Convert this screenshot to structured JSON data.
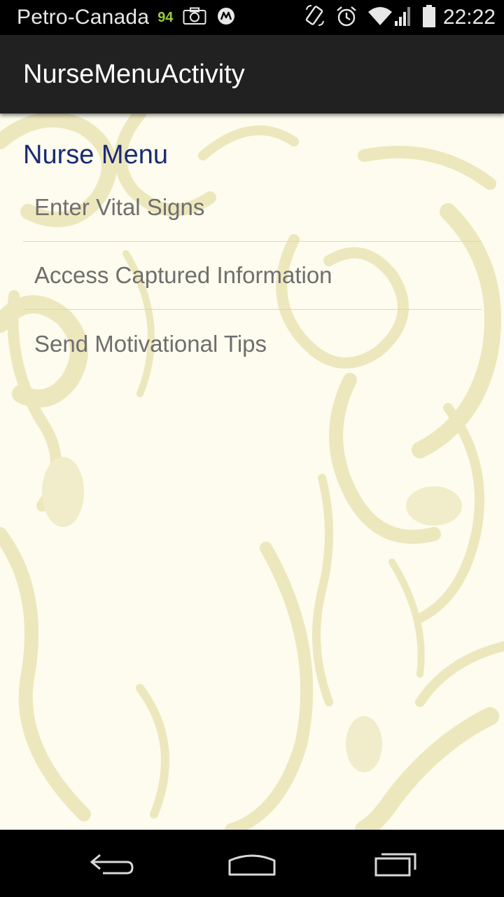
{
  "status_bar": {
    "carrier": "Petro-Canada",
    "badge": "94",
    "time": "22:22",
    "icons": [
      "camera-icon",
      "motorola-icon",
      "rotate-icon",
      "alarm-icon",
      "wifi-icon",
      "signal-icon",
      "battery-icon"
    ]
  },
  "action_bar": {
    "title": "NurseMenuActivity"
  },
  "main": {
    "section_title": "Nurse Menu",
    "menu_items": [
      {
        "label": "Enter Vital Signs"
      },
      {
        "label": "Access Captured Information"
      },
      {
        "label": "Send Motivational Tips"
      }
    ]
  },
  "nav_bar": {
    "icons": [
      "back-icon",
      "home-icon",
      "recents-icon"
    ]
  },
  "colors": {
    "action_bar": "#212121",
    "section_title": "#1a2a78",
    "menu_text": "#6e6e6e",
    "background": "#fdfcee",
    "swirl": "#ede7bd"
  }
}
